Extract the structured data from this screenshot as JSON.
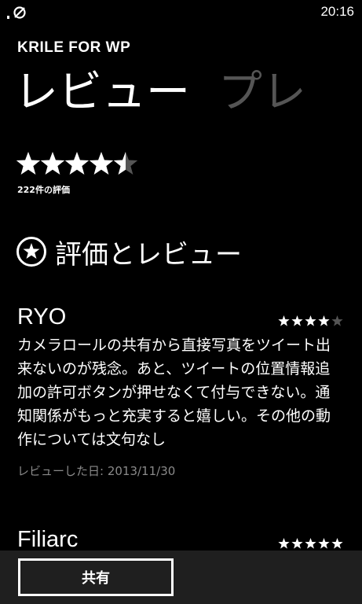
{
  "status_bar": {
    "time": "20:16",
    "signal_icon": "no-signal-icon"
  },
  "app": {
    "title": "KRILE FOR WP"
  },
  "pivot": {
    "active": "レビュー",
    "next": "プレ"
  },
  "rating": {
    "stars": 4.5,
    "count_label": "222件の評価"
  },
  "section": {
    "icon": "star-circle-icon",
    "title": "評価とレビュー"
  },
  "reviews": [
    {
      "author": "RYO",
      "stars": 4,
      "text": "カメラロールの共有から直接写真をツイート出来ないのが残念。あと、ツイートの位置情報追加の許可ボタンが押せなくて付与できない。通知関係がもっと充実すると嬉しい。その他の動作については文句なし",
      "date": "レビューした日: 2013/11/30"
    },
    {
      "author": "Filiarc",
      "stars": 5
    }
  ],
  "app_bar": {
    "share_label": "共有"
  },
  "colors": {
    "background": "#000000",
    "text": "#ffffff",
    "inactive_pivot": "#555555",
    "date_text": "#8a8a8a",
    "app_bar": "#1f1f1f",
    "empty_star": "#555555"
  }
}
